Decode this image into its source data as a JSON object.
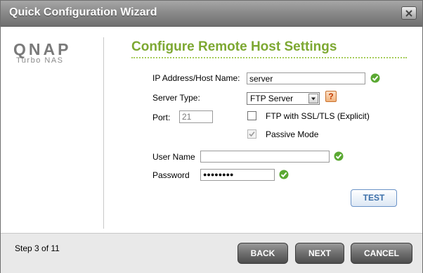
{
  "window": {
    "title": "Quick Configuration Wizard",
    "close_icon": "close-icon"
  },
  "brand": {
    "logo_text": "QNAP",
    "logo_subtitle": "Turbo NAS"
  },
  "section": {
    "title": "Configure Remote Host Settings",
    "accent_color": "#7da832"
  },
  "form": {
    "host": {
      "label": "IP Address/Host Name:",
      "value": "server",
      "status_icon": "check-icon"
    },
    "server_type": {
      "label": "Server Type:",
      "selected": "FTP Server",
      "help_icon": "help-icon"
    },
    "port": {
      "label": "Port:",
      "value": "21"
    },
    "ssl": {
      "label": "FTP with SSL/TLS (Explicit)",
      "checked": false
    },
    "passive": {
      "label": "Passive Mode",
      "checked": true,
      "disabled": true
    },
    "username": {
      "label": "User Name",
      "value": "",
      "status_icon": "check-icon"
    },
    "password": {
      "label": "Password",
      "value": "●●●●●●●●",
      "status_icon": "check-icon"
    },
    "test_button": "TEST"
  },
  "footer": {
    "step": "Step 3 of 11",
    "back_label": "BACK",
    "next_label": "NEXT",
    "cancel_label": "CANCEL"
  }
}
